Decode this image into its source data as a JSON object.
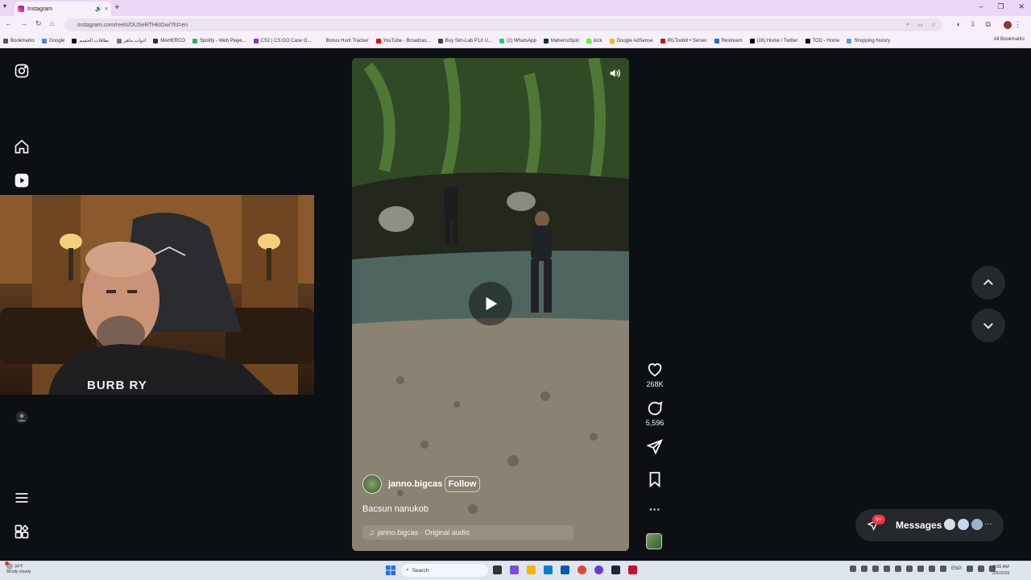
{
  "browser": {
    "tab_title": "Instagram",
    "tab_close": "×",
    "new_tab": "+",
    "url": "instagram.com/reels/DUSeRTHktGw/?hl=en",
    "window_controls": [
      "–",
      "❐",
      "✕"
    ],
    "bookmarks": [
      {
        "label": "Bookmarks",
        "color": "#555"
      },
      {
        "label": "Google",
        "color": "#4285f4"
      },
      {
        "label": "بطاقات الحسم",
        "color": "#111"
      },
      {
        "label": "ادوات ماهر",
        "color": "#777"
      },
      {
        "label": "MAHERCO",
        "color": "#333"
      },
      {
        "label": "Spotify - Web Playe...",
        "color": "#1db954"
      },
      {
        "label": "CS2 | CS:GO Case O...",
        "color": "#8b2fd6"
      },
      {
        "label": "Bonus Hunt Tracker",
        "color": "#f5f0fa"
      },
      {
        "label": "YouTube - Broadcas...",
        "color": "#e00"
      },
      {
        "label": "Buy Sim-Lab P1X U...",
        "color": "#444"
      },
      {
        "label": "(2) WhatsApp",
        "color": "#25d366"
      },
      {
        "label": "MahercoSpin",
        "color": "#112a55"
      },
      {
        "label": "kick",
        "color": "#53fc18"
      },
      {
        "label": "Google AdSense",
        "color": "#fbbc04"
      },
      {
        "label": "IRLToolkit • Server",
        "color": "#c11"
      },
      {
        "label": "Restream",
        "color": "#1a6ef5"
      },
      {
        "label": "(16) Home / Twitter",
        "color": "#000"
      },
      {
        "label": "TOD - Home",
        "color": "#111"
      },
      {
        "label": "Shopping history",
        "color": "#5aa0d8"
      }
    ],
    "all_bookmarks": "All Bookmarks"
  },
  "sidebar": {
    "logo_icon": "instagram-icon",
    "items": [
      {
        "name": "home-icon"
      },
      {
        "name": "reels-icon"
      },
      {
        "name": "profile-avatar"
      }
    ],
    "more_icon": "menu-icon",
    "also_from_meta_icon": "apps-icon"
  },
  "reel": {
    "author": "janno.bigcas",
    "follow_label": "Follow",
    "caption": "Bacsun nanukob",
    "audio": "janno.bigcas · Original audio",
    "likes": "268K",
    "comments": "5,596",
    "more_label": "···"
  },
  "messages": {
    "label": "Messages",
    "badge": "9+"
  },
  "webcam": {
    "shirt_text": "BURB RY"
  },
  "taskbar": {
    "weather_temp": "34°F",
    "weather_desc": "Mostly cloudy",
    "search_placeholder": "Search",
    "lang": "ENG",
    "time": "2:05 AM",
    "date": "2/5/2026"
  }
}
